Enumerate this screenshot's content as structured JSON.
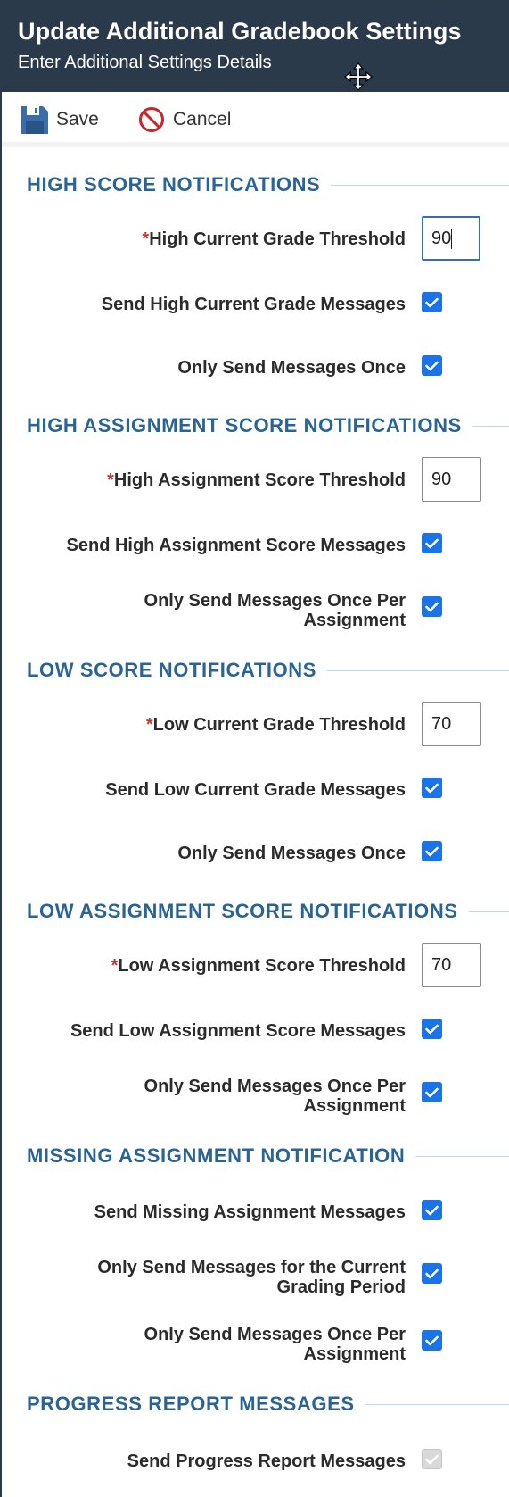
{
  "header": {
    "title": "Update Additional Gradebook Settings",
    "subtitle": "Enter Additional Settings Details",
    "move_icon": "move-icon"
  },
  "toolbar": {
    "save_label": "Save",
    "cancel_label": "Cancel",
    "save_icon": "floppy-disk-icon",
    "cancel_icon": "prohibited-icon"
  },
  "colors": {
    "header_bg": "#2b3a4a",
    "section_title": "#2a6496",
    "checkbox": "#1a73e8",
    "required": "#c0392b"
  },
  "sections": {
    "high_score": {
      "title": "HIGH SCORE NOTIFICATIONS",
      "threshold_label": "High Current Grade Threshold",
      "threshold_value": "90",
      "send_label": "Send High Current Grade Messages",
      "send_checked": true,
      "once_label": "Only Send Messages Once",
      "once_checked": true
    },
    "high_assignment": {
      "title": "HIGH ASSIGNMENT SCORE NOTIFICATIONS",
      "threshold_label": "High Assignment Score Threshold",
      "threshold_value": "90",
      "send_label": "Send High Assignment Score Messages",
      "send_checked": true,
      "once_label_line1": "Only Send Messages Once Per",
      "once_label_line2": "Assignment",
      "once_checked": true
    },
    "low_score": {
      "title": "LOW SCORE NOTIFICATIONS",
      "threshold_label": "Low Current Grade Threshold",
      "threshold_value": "70",
      "send_label": "Send Low Current Grade Messages",
      "send_checked": true,
      "once_label": "Only Send Messages Once",
      "once_checked": true
    },
    "low_assignment": {
      "title": "LOW ASSIGNMENT SCORE NOTIFICATIONS",
      "threshold_label": "Low Assignment Score Threshold",
      "threshold_value": "70",
      "send_label": "Send Low Assignment Score Messages",
      "send_checked": true,
      "once_label_line1": "Only Send Messages Once Per",
      "once_label_line2": "Assignment",
      "once_checked": true
    },
    "missing": {
      "title": "MISSING ASSIGNMENT NOTIFICATION",
      "send_label": "Send Missing Assignment Messages",
      "send_checked": true,
      "period_label_line1": "Only Send Messages for the Current",
      "period_label_line2": "Grading Period",
      "period_checked": true,
      "once_label_line1": "Only Send Messages Once Per",
      "once_label_line2": "Assignment",
      "once_checked": true
    },
    "progress": {
      "title": "PROGRESS REPORT MESSAGES",
      "send_label": "Send Progress Report Messages",
      "send_checked": true,
      "send_disabled": true
    }
  },
  "required_marker": "*"
}
